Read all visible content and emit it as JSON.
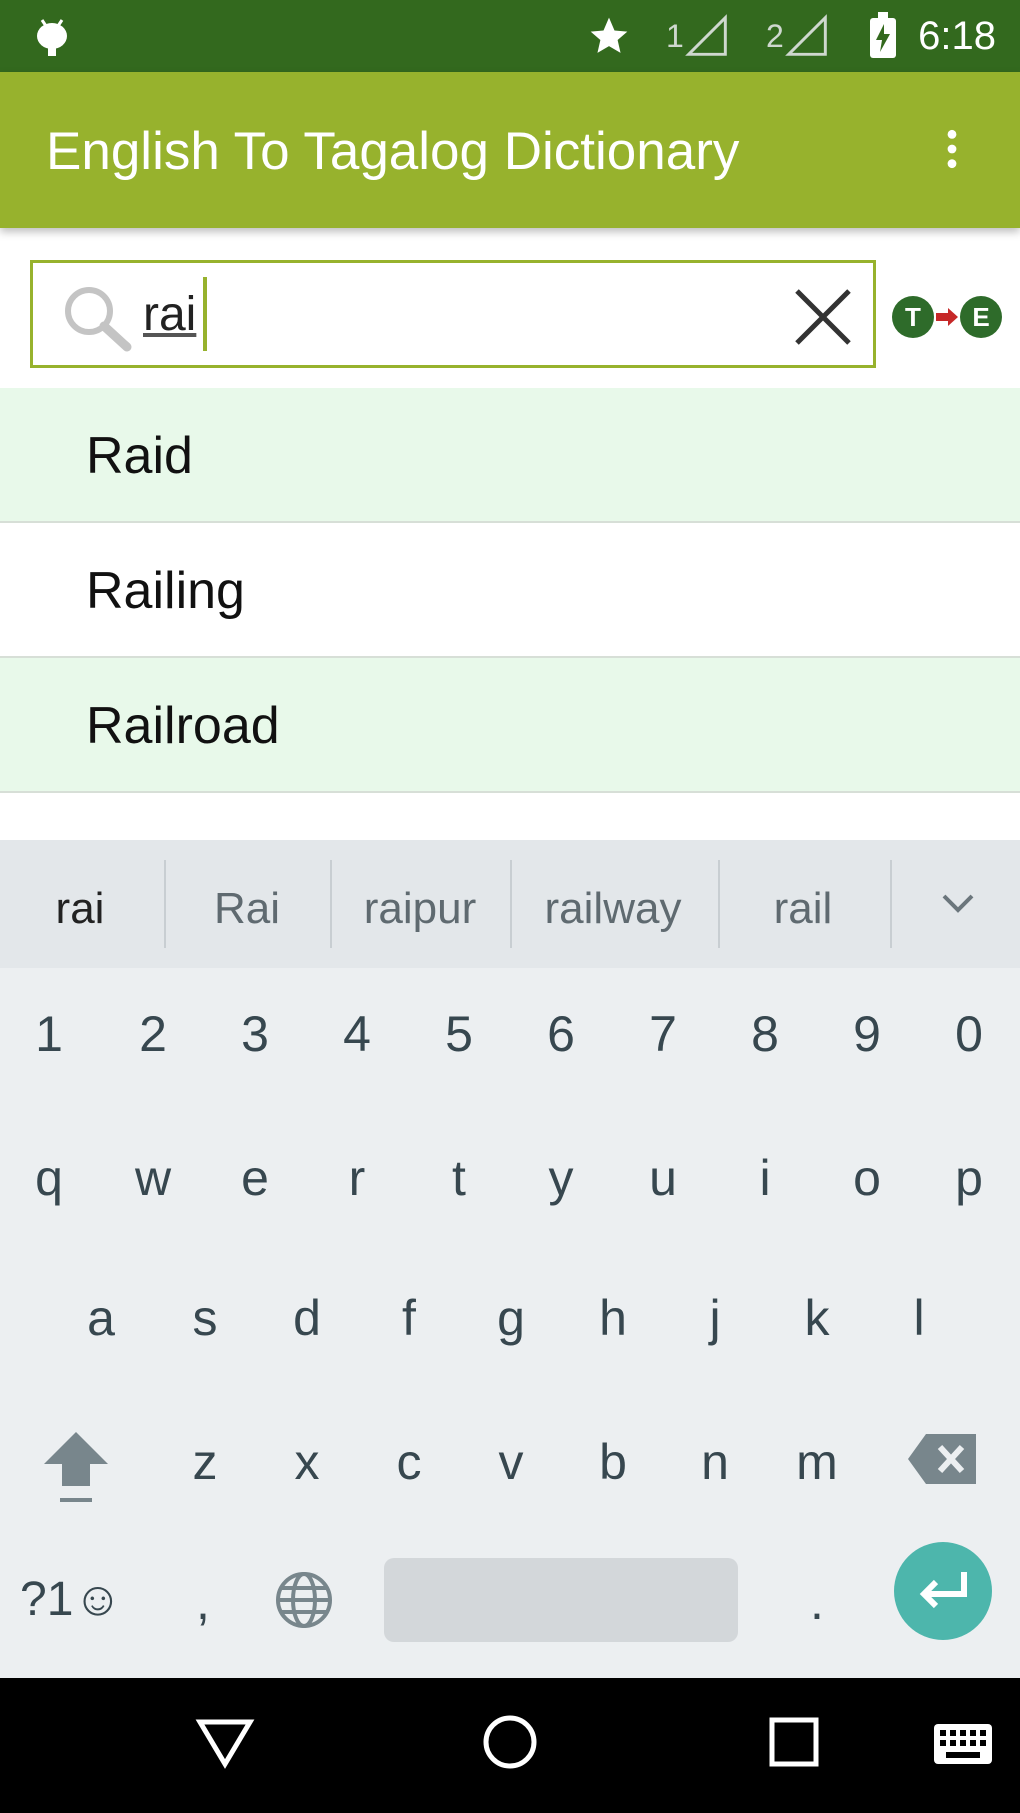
{
  "status_bar": {
    "time": "6:18",
    "sim1_label": "1",
    "sim2_label": "2",
    "icons": [
      "android-icon",
      "star-icon",
      "signal-icon",
      "battery-charging-icon"
    ]
  },
  "toolbar": {
    "title": "English To Tagalog Dictionary",
    "menu_icon": "overflow-menu-icon"
  },
  "search": {
    "value": "rai",
    "clear_icon": "close-icon",
    "toggle_left": "T",
    "toggle_right": "E"
  },
  "results": [
    {
      "label": "Raid"
    },
    {
      "label": "Railing"
    },
    {
      "label": "Railroad"
    }
  ],
  "keyboard": {
    "suggestions": [
      "rai",
      "Rai",
      "raipur",
      "railway",
      "rail"
    ],
    "numbers": [
      "1",
      "2",
      "3",
      "4",
      "5",
      "6",
      "7",
      "8",
      "9",
      "0"
    ],
    "row1": [
      "q",
      "w",
      "e",
      "r",
      "t",
      "y",
      "u",
      "i",
      "o",
      "p"
    ],
    "row2": [
      "a",
      "s",
      "d",
      "f",
      "g",
      "h",
      "j",
      "k",
      "l"
    ],
    "row3": [
      "z",
      "x",
      "c",
      "v",
      "b",
      "n",
      "m"
    ],
    "symbols_label": "?1☺",
    "comma": ",",
    "period": ".",
    "accent": "#4db6ac"
  },
  "colors": {
    "status_bar": "#33691e",
    "toolbar": "#97b22d",
    "row_highlight": "#e8f9ea"
  }
}
